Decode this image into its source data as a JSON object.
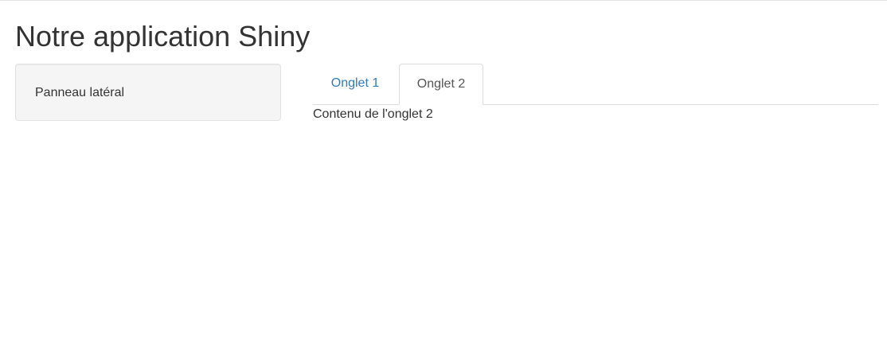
{
  "app": {
    "title": "Notre application Shiny"
  },
  "sidebar": {
    "text": "Panneau latéral"
  },
  "tabs": [
    {
      "label": "Onglet 1",
      "active": false
    },
    {
      "label": "Onglet 2",
      "active": true
    }
  ],
  "main": {
    "content": "Contenu de l'onglet 2"
  },
  "colors": {
    "link": "#337ab7",
    "active_tab_text": "#555555",
    "panel_background": "#f5f5f5",
    "border": "#dddddd"
  }
}
